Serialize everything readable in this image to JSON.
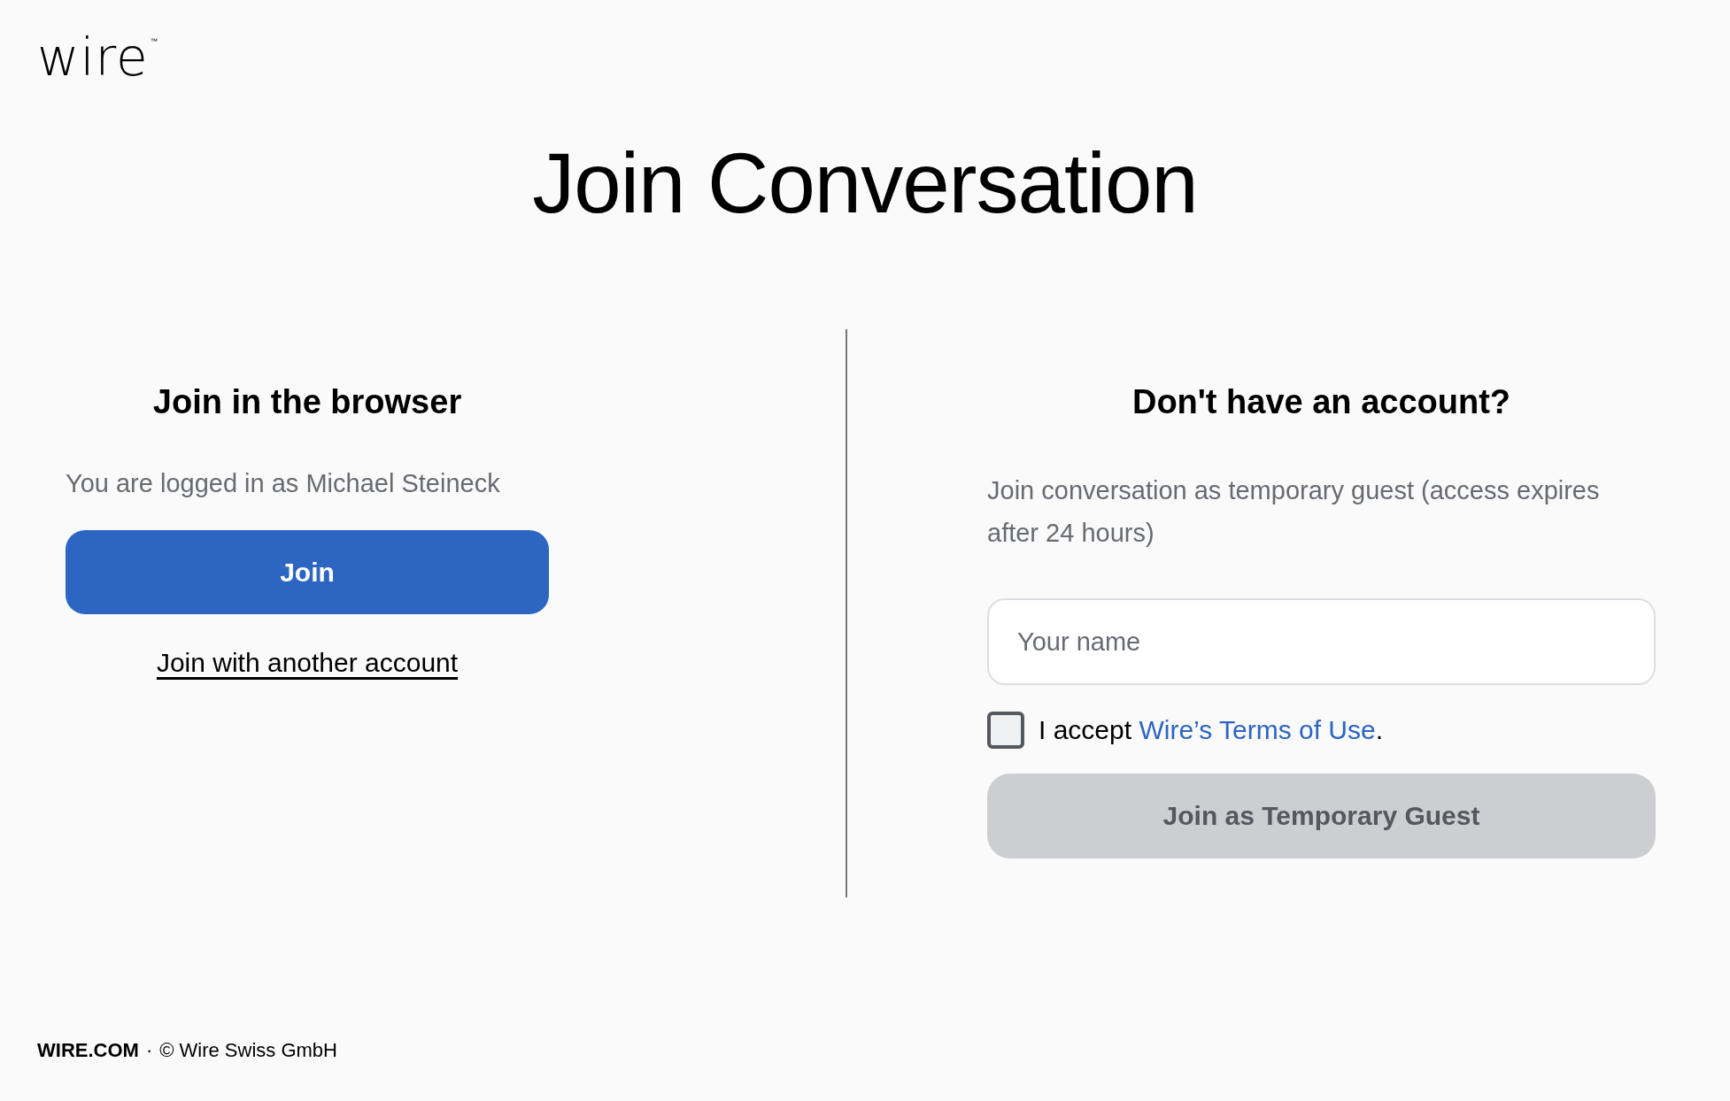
{
  "logo": {
    "text": "wire",
    "mark": "™"
  },
  "title": "Join Conversation",
  "browser": {
    "heading": "Join in the browser",
    "status": "You are logged in as Michael Steineck",
    "join_button": "Join",
    "other_account_link": "Join with another account"
  },
  "guest": {
    "heading": "Don't have an account?",
    "description": "Join conversation as temporary guest (access expires after 24 hours)",
    "name_field": {
      "placeholder": "Your name"
    },
    "terms": {
      "checked": false,
      "prefix": "I accept",
      "link": "Wire’s Terms of Use",
      "suffix": "."
    },
    "guest_button": {
      "label": "Join as Temporary Guest",
      "disabled": true
    }
  },
  "footer": {
    "link": "WIRE.COM",
    "separator": "·",
    "copyright": "© Wire Swiss GmbH"
  }
}
